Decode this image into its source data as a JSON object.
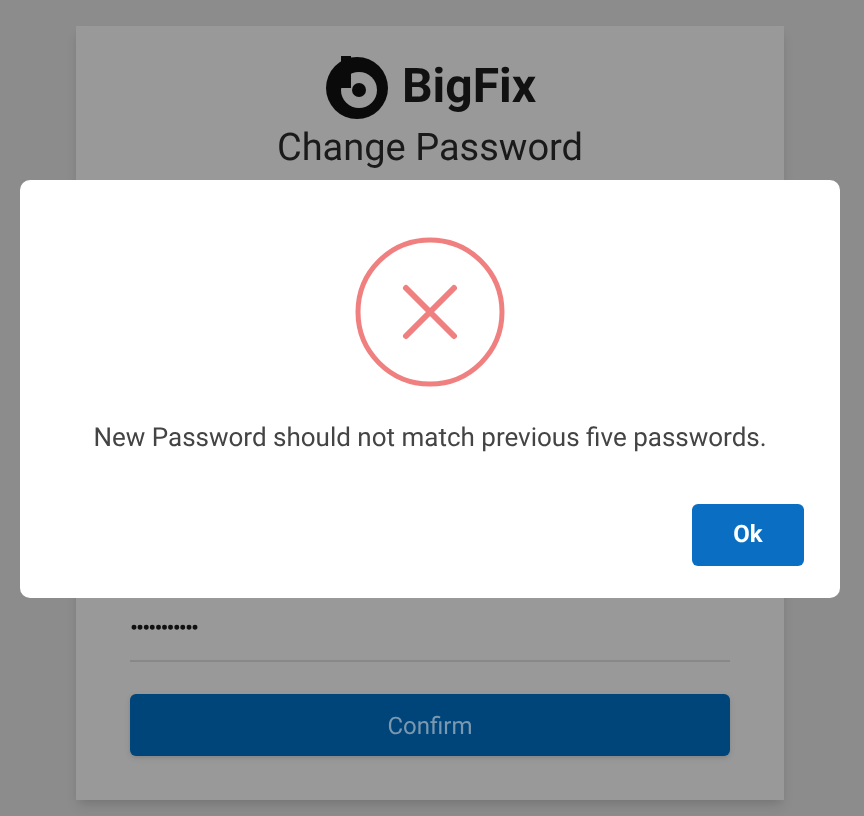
{
  "logo": {
    "text": "BigFix"
  },
  "title": "Change Password",
  "password_field": {
    "value": "•••••••••••"
  },
  "confirm_button": "Confirm",
  "dialog": {
    "message": "New Password should not match previous five passwords.",
    "ok_button": "Ok"
  }
}
